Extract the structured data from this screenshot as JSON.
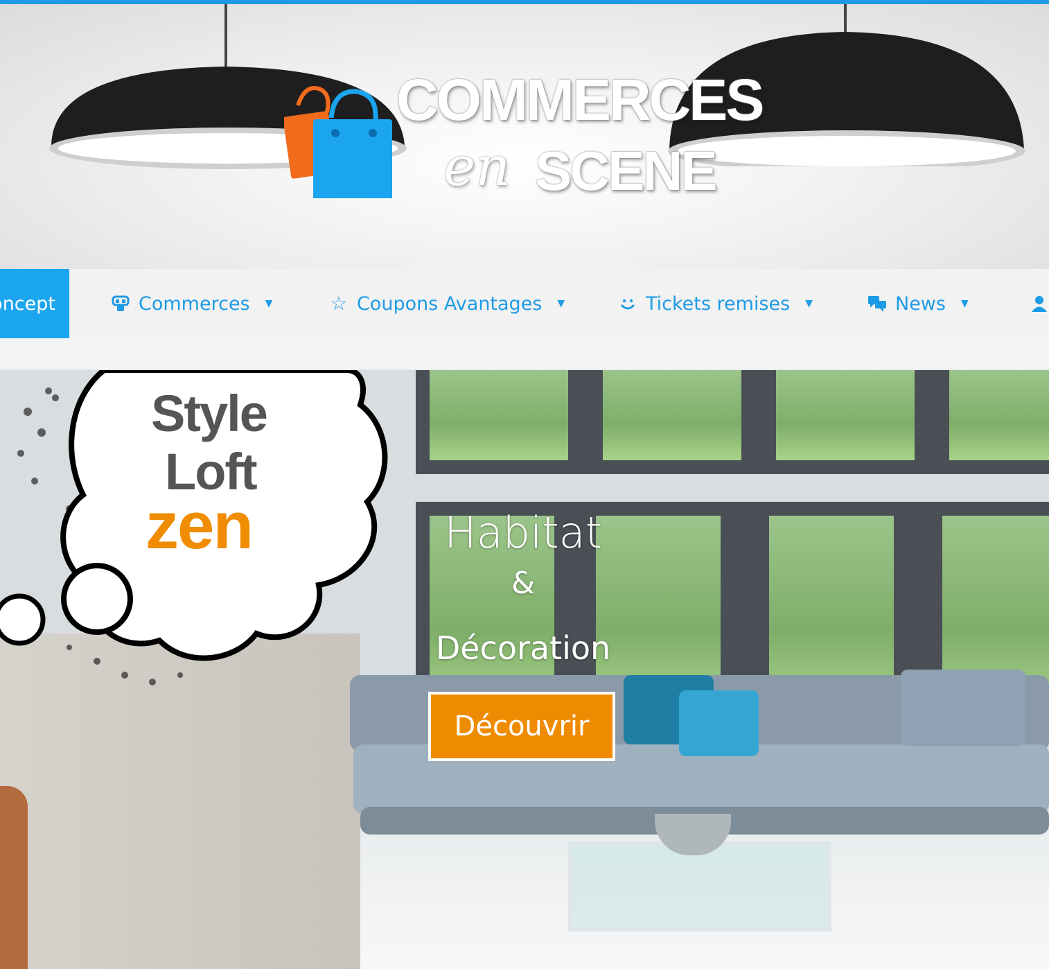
{
  "header": {
    "logo_word1": "COMMERCES",
    "logo_word_en": "en",
    "logo_word2": "SCENE"
  },
  "nav": {
    "items": [
      {
        "label": "Concept",
        "icon": "none",
        "active": true
      },
      {
        "label": "Commerces",
        "icon": "store-icon"
      },
      {
        "label": "Coupons Avantages",
        "icon": "star-icon"
      },
      {
        "label": "Tickets remises",
        "icon": "smile-icon"
      },
      {
        "label": "News",
        "icon": "chat-icon"
      },
      {
        "label": "",
        "icon": "user-icon"
      }
    ]
  },
  "hero": {
    "bubble_line1": "Style",
    "bubble_line2": "Loft",
    "bubble_line3": "zen",
    "title": "Habitat",
    "amp": "&",
    "subtitle": "Décoration",
    "cta_label": "Découvrir"
  },
  "colors": {
    "accent_blue": "#1e9be6",
    "cta_orange": "#ef8b00",
    "bag_blue": "#1ca5ef",
    "bag_orange": "#f26b1d"
  }
}
